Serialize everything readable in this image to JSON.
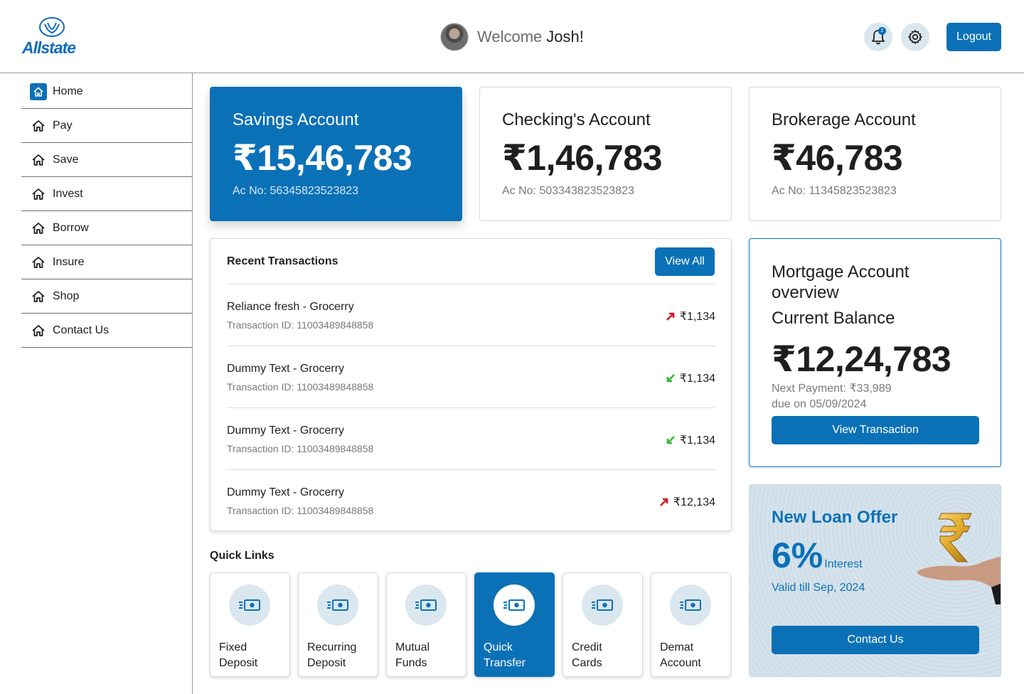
{
  "header": {
    "logo_text": "Allstate",
    "welcome_prefix": "Welcome",
    "user_name": "Josh!",
    "notification_count": "2",
    "logout_label": "Logout"
  },
  "sidebar": {
    "items": [
      {
        "label": "Home",
        "icon": "home-icon",
        "active": true
      },
      {
        "label": "Pay",
        "icon": "home-icon"
      },
      {
        "label": "Save",
        "icon": "home-icon"
      },
      {
        "label": "Invest",
        "icon": "home-icon"
      },
      {
        "label": "Borrow",
        "icon": "home-icon"
      },
      {
        "label": "Insure",
        "icon": "home-icon"
      },
      {
        "label": "Shop",
        "icon": "home-icon"
      },
      {
        "label": "Contact Us",
        "icon": "home-icon"
      }
    ]
  },
  "accounts": [
    {
      "title": "Savings Account",
      "balance": "₹15,46,783",
      "acno": "Ac No: 56345823523823"
    },
    {
      "title": "Checking's Account",
      "balance": "₹1,46,783",
      "acno": "Ac No: 503343823523823"
    },
    {
      "title": "Brokerage Account",
      "balance": "₹46,783",
      "acno": "Ac No: 11345823523823"
    }
  ],
  "transactions": {
    "title": "Recent Transactions",
    "view_all_label": "View All",
    "rows": [
      {
        "name": "Reliance fresh - Grocerry",
        "id": "Transaction ID: 11003489848858",
        "amount": "₹1,134",
        "direction": "up"
      },
      {
        "name": "Dummy Text - Grocerry",
        "id": "Transaction ID: 11003489848858",
        "amount": "₹1,134",
        "direction": "down"
      },
      {
        "name": "Dummy Text - Grocerry",
        "id": "Transaction ID: 11003489848858",
        "amount": "₹1,134",
        "direction": "down"
      },
      {
        "name": "Dummy Text - Grocerry",
        "id": "Transaction ID: 11003489848858",
        "amount": "₹12,134",
        "direction": "up"
      }
    ]
  },
  "quick_links": {
    "title": "Quick Links",
    "items": [
      {
        "line1": "Fixed",
        "line2": "Deposit"
      },
      {
        "line1": "Recurring",
        "line2": "Deposit"
      },
      {
        "line1": "Mutual",
        "line2": "Funds"
      },
      {
        "line1": "Quick",
        "line2": "Transfer",
        "active": true
      },
      {
        "line1": "Credit",
        "line2": "Cards"
      },
      {
        "line1": "Demat",
        "line2": "Account"
      }
    ]
  },
  "mortgage": {
    "title": "Mortgage Account overview",
    "subtitle": "Current Balance",
    "balance": "₹12,24,783",
    "next_payment": "Next Payment: ₹33,989",
    "due": "due on 05/09/2024",
    "button_label": "View Transaction"
  },
  "loan_offer": {
    "title": "New Loan Offer",
    "rate": "6%",
    "rate_suffix": "Interest",
    "valid": "Valid till Sep, 2024",
    "button_label": "Contact Us"
  },
  "colors": {
    "brand": "#0b71b7",
    "up_arrow": "#d0191f",
    "down_arrow": "#2ebd2e",
    "icon_bg": "#dbe7ef"
  }
}
